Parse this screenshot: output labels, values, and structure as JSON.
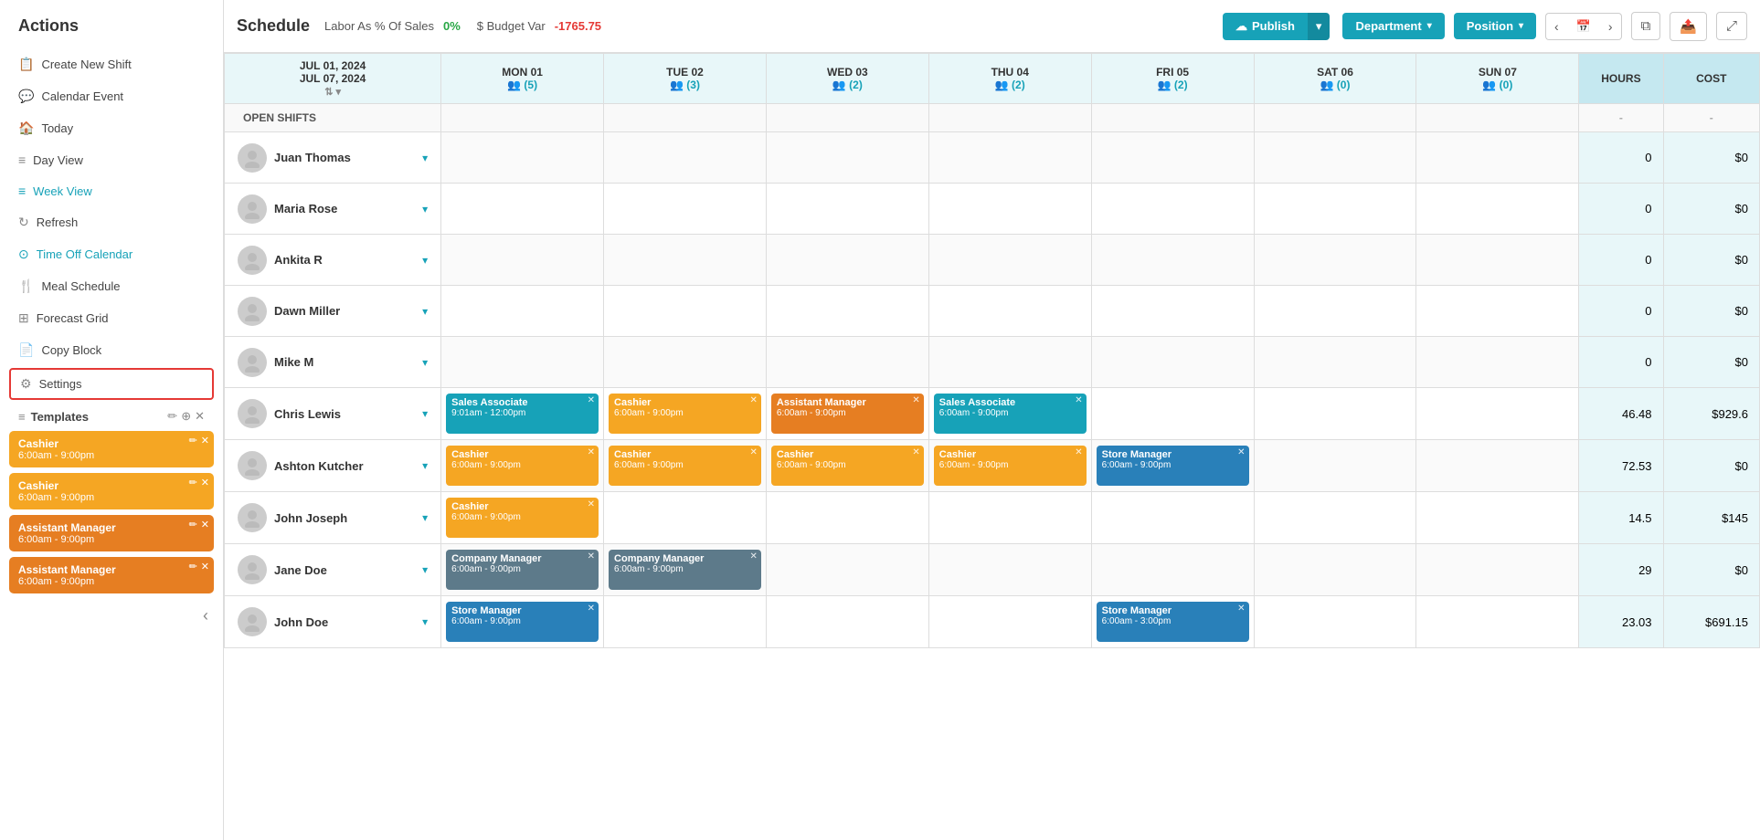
{
  "sidebar": {
    "title": "Actions",
    "items": [
      {
        "id": "create-shift",
        "icon": "📋",
        "label": "Create New Shift"
      },
      {
        "id": "calendar-event",
        "icon": "💬",
        "label": "Calendar Event"
      },
      {
        "id": "today",
        "icon": "🏠",
        "label": "Today"
      },
      {
        "id": "day-view",
        "icon": "≡",
        "label": "Day View"
      },
      {
        "id": "week-view",
        "icon": "≡",
        "label": "Week View"
      },
      {
        "id": "refresh",
        "icon": "↻",
        "label": "Refresh"
      },
      {
        "id": "time-off",
        "icon": "⊙",
        "label": "Time Off Calendar",
        "teal": true
      },
      {
        "id": "meal-schedule",
        "icon": "🍴",
        "label": "Meal Schedule"
      },
      {
        "id": "forecast-grid",
        "icon": "⊞",
        "label": "Forecast Grid"
      },
      {
        "id": "copy-block",
        "icon": "📄",
        "label": "Copy Block"
      },
      {
        "id": "settings",
        "icon": "⚙",
        "label": "Settings"
      }
    ],
    "templates_label": "Templates",
    "templates": [
      {
        "role": "Cashier",
        "time": "6:00am - 9:00pm",
        "color": "yellow"
      },
      {
        "role": "Cashier",
        "time": "6:00am - 9:00pm",
        "color": "yellow"
      },
      {
        "role": "Assistant Manager",
        "time": "6:00am - 9:00pm",
        "color": "orange"
      },
      {
        "role": "Assistant Manager",
        "time": "6:00am - 9:00pm",
        "color": "orange"
      }
    ]
  },
  "topbar": {
    "schedule_label": "Schedule",
    "labor_label": "Labor As % Of Sales",
    "labor_pct": "0%",
    "budget_label": "$ Budget Var",
    "budget_val": "-1765.75",
    "publish_label": "Publish",
    "dept_label": "Department",
    "pos_label": "Position"
  },
  "grid": {
    "date_range": "JUL 01, 2024\nJUL 07, 2024",
    "date_range_line1": "JUL 01, 2024",
    "date_range_line2": "JUL 07, 2024",
    "open_shifts_label": "OPEN SHIFTS",
    "hours_label": "HOURS",
    "cost_label": "COST",
    "days": [
      {
        "label": "MON 01",
        "count": "5"
      },
      {
        "label": "TUE 02",
        "count": "3"
      },
      {
        "label": "WED 03",
        "count": "2"
      },
      {
        "label": "THU 04",
        "count": "2"
      },
      {
        "label": "FRI 05",
        "count": "2"
      },
      {
        "label": "SAT 06",
        "count": "0"
      },
      {
        "label": "SUN 07",
        "count": "0"
      }
    ],
    "employees": [
      {
        "name": "Juan Thomas",
        "shifts": [
          null,
          null,
          null,
          null,
          null,
          null,
          null
        ],
        "hours": "0",
        "cost": "$0"
      },
      {
        "name": "Maria Rose",
        "shifts": [
          null,
          null,
          null,
          null,
          null,
          null,
          null
        ],
        "hours": "0",
        "cost": "$0"
      },
      {
        "name": "Ankita R",
        "shifts": [
          null,
          null,
          null,
          null,
          null,
          null,
          null
        ],
        "hours": "0",
        "cost": "$0"
      },
      {
        "name": "Dawn Miller",
        "shifts": [
          null,
          null,
          null,
          null,
          null,
          null,
          null
        ],
        "hours": "0",
        "cost": "$0"
      },
      {
        "name": "Mike M",
        "shifts": [
          null,
          null,
          null,
          null,
          null,
          null,
          null
        ],
        "hours": "0",
        "cost": "$0"
      },
      {
        "name": "Chris Lewis",
        "shifts": [
          {
            "role": "Sales Associate",
            "time": "9:01am - 12:00pm",
            "color": "teal"
          },
          {
            "role": "Cashier",
            "time": "6:00am - 9:00pm",
            "color": "yellow"
          },
          {
            "role": "Assistant Manager",
            "time": "6:00am - 9:00pm",
            "color": "orange"
          },
          {
            "role": "Sales Associate",
            "time": "6:00am - 9:00pm",
            "color": "teal"
          },
          null,
          null,
          null
        ],
        "hours": "46.48",
        "cost": "$929.6"
      },
      {
        "name": "Ashton Kutcher",
        "shifts": [
          {
            "role": "Cashier",
            "time": "6:00am - 9:00pm",
            "color": "yellow"
          },
          {
            "role": "Cashier",
            "time": "6:00am - 9:00pm",
            "color": "yellow"
          },
          {
            "role": "Cashier",
            "time": "6:00am - 9:00pm",
            "color": "yellow"
          },
          {
            "role": "Cashier",
            "time": "6:00am - 9:00pm",
            "color": "yellow"
          },
          {
            "role": "Store Manager",
            "time": "6:00am - 9:00pm",
            "color": "blue"
          },
          null,
          null
        ],
        "hours": "72.53",
        "cost": "$0"
      },
      {
        "name": "John Joseph",
        "shifts": [
          {
            "role": "Cashier",
            "time": "6:00am - 9:00pm",
            "color": "yellow"
          },
          null,
          null,
          null,
          null,
          null,
          null
        ],
        "hours": "14.5",
        "cost": "$145"
      },
      {
        "name": "Jane Doe",
        "shifts": [
          {
            "role": "Company Manager",
            "time": "6:00am - 9:00pm",
            "color": "gray"
          },
          {
            "role": "Company Manager",
            "time": "6:00am - 9:00pm",
            "color": "gray"
          },
          null,
          null,
          null,
          null,
          null
        ],
        "hours": "29",
        "cost": "$0"
      },
      {
        "name": "John Doe",
        "shifts": [
          {
            "role": "Store Manager",
            "time": "6:00am - 9:00pm",
            "color": "blue"
          },
          null,
          null,
          null,
          {
            "role": "Store Manager",
            "time": "6:00am - 3:00pm",
            "color": "blue"
          },
          null,
          null
        ],
        "hours": "23.03",
        "cost": "$691.15"
      }
    ]
  }
}
